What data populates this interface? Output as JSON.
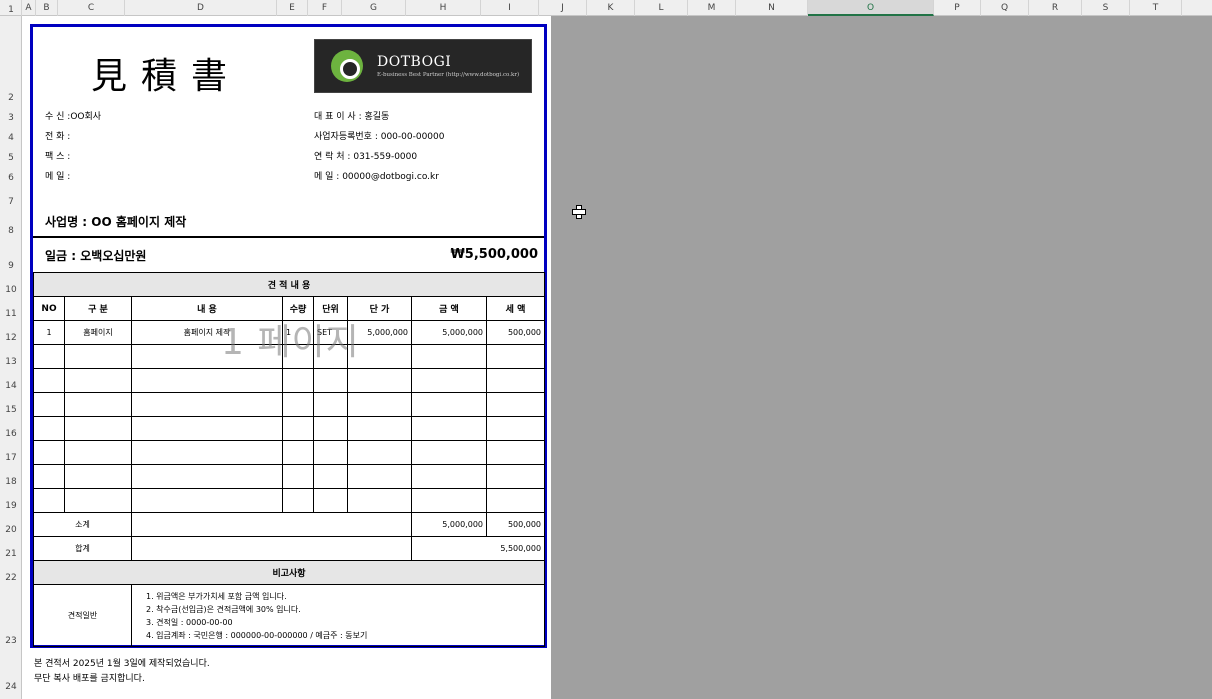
{
  "columns": [
    "A",
    "B",
    "C",
    "D",
    "E",
    "F",
    "G",
    "H",
    "I",
    "J",
    "K",
    "L",
    "M",
    "N",
    "O",
    "P",
    "Q",
    "R",
    "S",
    "T"
  ],
  "selected_column": "O",
  "rows": [
    "1",
    "2",
    "3",
    "4",
    "5",
    "6",
    "7",
    "8",
    "9",
    "10",
    "11",
    "12",
    "13",
    "14",
    "15",
    "16",
    "17",
    "18",
    "19",
    "20",
    "21",
    "22",
    "23",
    "24"
  ],
  "doc": {
    "title": "見積書",
    "logo": {
      "name": "DOTBOGI",
      "tagline": "E-business Best Partner (http://www.dotbogi.co.kr)"
    },
    "recipient": [
      {
        "label": "수 신 :",
        "value": "OO회사"
      },
      {
        "label": "전 화 :",
        "value": ""
      },
      {
        "label": "팩 스 :",
        "value": ""
      },
      {
        "label": "메 일 :",
        "value": ""
      }
    ],
    "supplier": [
      {
        "label": "대 표 이 사 :",
        "value": "홍길동"
      },
      {
        "label": "사업자등록번호 :",
        "value": "000-00-00000"
      },
      {
        "label": "연 락 처 :",
        "value": "031-559-0000"
      },
      {
        "label": "메 일 :",
        "value": "00000@dotbogi.co.kr"
      }
    ],
    "project": "사업명 : OO 홈페이지 제작",
    "amount_words": "일금 : 오백오십만원",
    "amount_total": "₩5,500,000",
    "section_title": "견 적 내 용",
    "headers": [
      "NO",
      "구 분",
      "내 용",
      "수량",
      "단위",
      "단 가",
      "금 액",
      "세 액"
    ],
    "items": [
      [
        "1",
        "홈페이지",
        "홈페이지 제작",
        "1",
        "SET",
        "5,000,000",
        "5,000,000",
        "500,000"
      ]
    ],
    "subtotal": {
      "label": "소계",
      "amount": "5,000,000",
      "tax": "500,000"
    },
    "total": {
      "label": "합계",
      "amount": "5,500,000"
    },
    "remarks_title": "비고사항",
    "remarks_label": "견적일반",
    "remarks": [
      "1. 위금액은 부가가치세 포함 금액 입니다.",
      "2. 착수금(선입금)은 견적금액에 30% 입니다.",
      "3. 견적일 : 0000-00-00",
      "4. 입금계좌 : 국민은행 : 000000-00-000000  / 예금주 : 동보기"
    ],
    "watermark": "1 페이지"
  },
  "footer": [
    "본 견적서 2025년 1월  3일에 제작되었습니다.",
    "무단 복사 배포를 금지합니다."
  ]
}
